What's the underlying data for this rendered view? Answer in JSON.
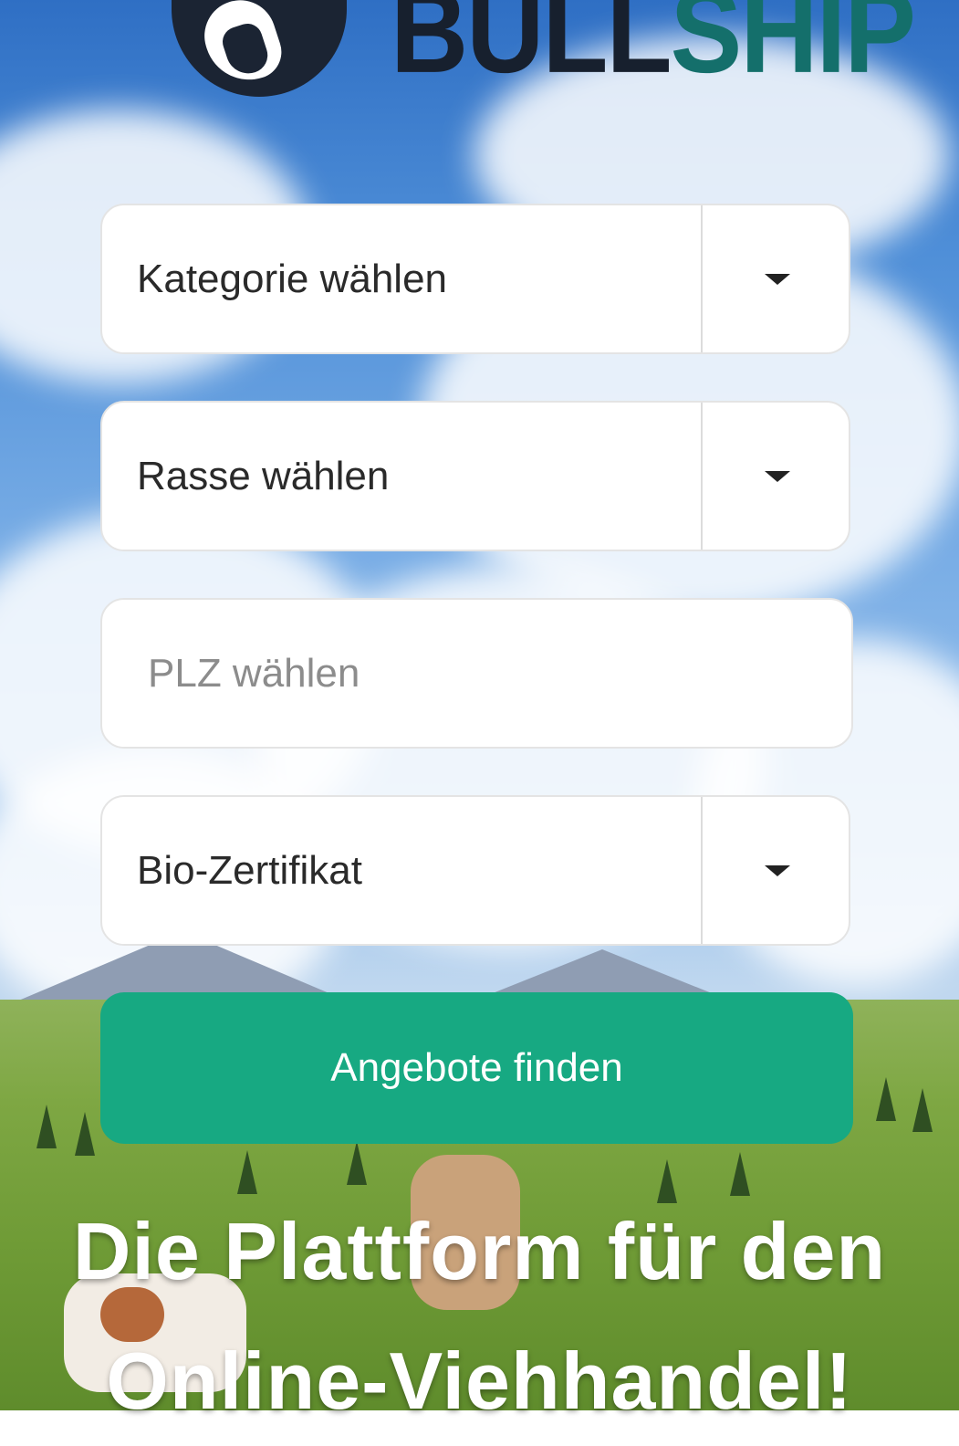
{
  "brand": {
    "logo_text_part1": "BULL",
    "logo_text_part2": "SHIP",
    "logo_icon": "bull-head-icon",
    "colors": {
      "dark": "#17202e",
      "teal": "#146f6b"
    }
  },
  "search_form": {
    "category_select": {
      "label": "Kategorie wählen",
      "icon": "caret-down-icon"
    },
    "breed_select": {
      "label": "Rasse wählen",
      "icon": "caret-down-icon"
    },
    "zip_input": {
      "placeholder": "PLZ wählen",
      "value": ""
    },
    "bio_select": {
      "label": "Bio-Zertifikat",
      "icon": "caret-down-icon"
    },
    "submit_label": "Angebote finden",
    "submit_color": "#17a982"
  },
  "hero": {
    "headline_line1": "Die Plattform für den",
    "headline_line2": "Online-Viehhandel!"
  }
}
